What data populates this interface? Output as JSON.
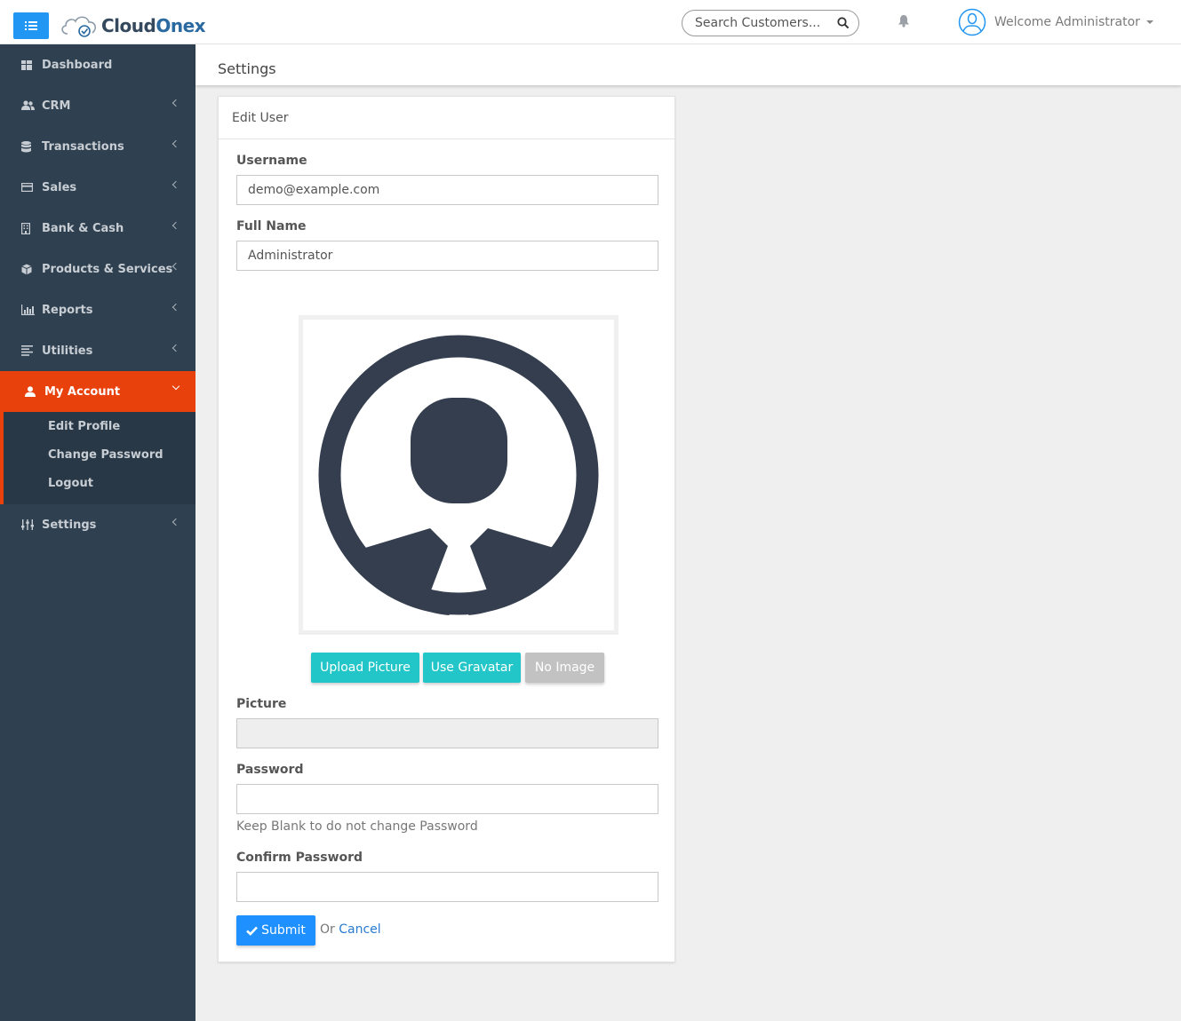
{
  "app": {
    "logo_main": "Cloud",
    "logo_accent": "Onex"
  },
  "topbar": {
    "search_placeholder": "Search Customers...",
    "welcome": "Welcome Administrator"
  },
  "sidebar": {
    "items": [
      {
        "label": "Dashboard",
        "icon": "dashboard-icon"
      },
      {
        "label": "CRM",
        "icon": "users-icon"
      },
      {
        "label": "Transactions",
        "icon": "database-icon"
      },
      {
        "label": "Sales",
        "icon": "credit-card-icon"
      },
      {
        "label": "Bank & Cash",
        "icon": "building-icon"
      },
      {
        "label": "Products & Services",
        "icon": "cube-icon"
      },
      {
        "label": "Reports",
        "icon": "bar-chart-icon"
      },
      {
        "label": "Utilities",
        "icon": "list-icon"
      },
      {
        "label": "My Account",
        "icon": "user-icon",
        "active": true
      },
      {
        "label": "Settings",
        "icon": "sliders-icon"
      }
    ],
    "submenu": [
      "Edit Profile",
      "Change Password",
      "Logout"
    ]
  },
  "page": {
    "title": "Settings"
  },
  "form": {
    "card_title": "Edit User",
    "username_label": "Username",
    "username_value": "demo@example.com",
    "fullname_label": "Full Name",
    "fullname_value": "Administrator",
    "upload_label": "Upload Picture",
    "gravatar_label": "Use Gravatar",
    "noimage_label": "No Image",
    "picture_label": "Picture",
    "picture_value": "",
    "password_label": "Password",
    "password_help": "Keep Blank to do not change Password",
    "confirm_label": "Confirm Password",
    "submit_label": "Submit",
    "or_text": "Or",
    "cancel_label": "Cancel"
  },
  "colors": {
    "sidebar_bg": "#2f4050",
    "active_item": "#e8410b",
    "primary": "#1e90ff",
    "teal": "#23c6c8",
    "avatar": "#343e4e"
  }
}
